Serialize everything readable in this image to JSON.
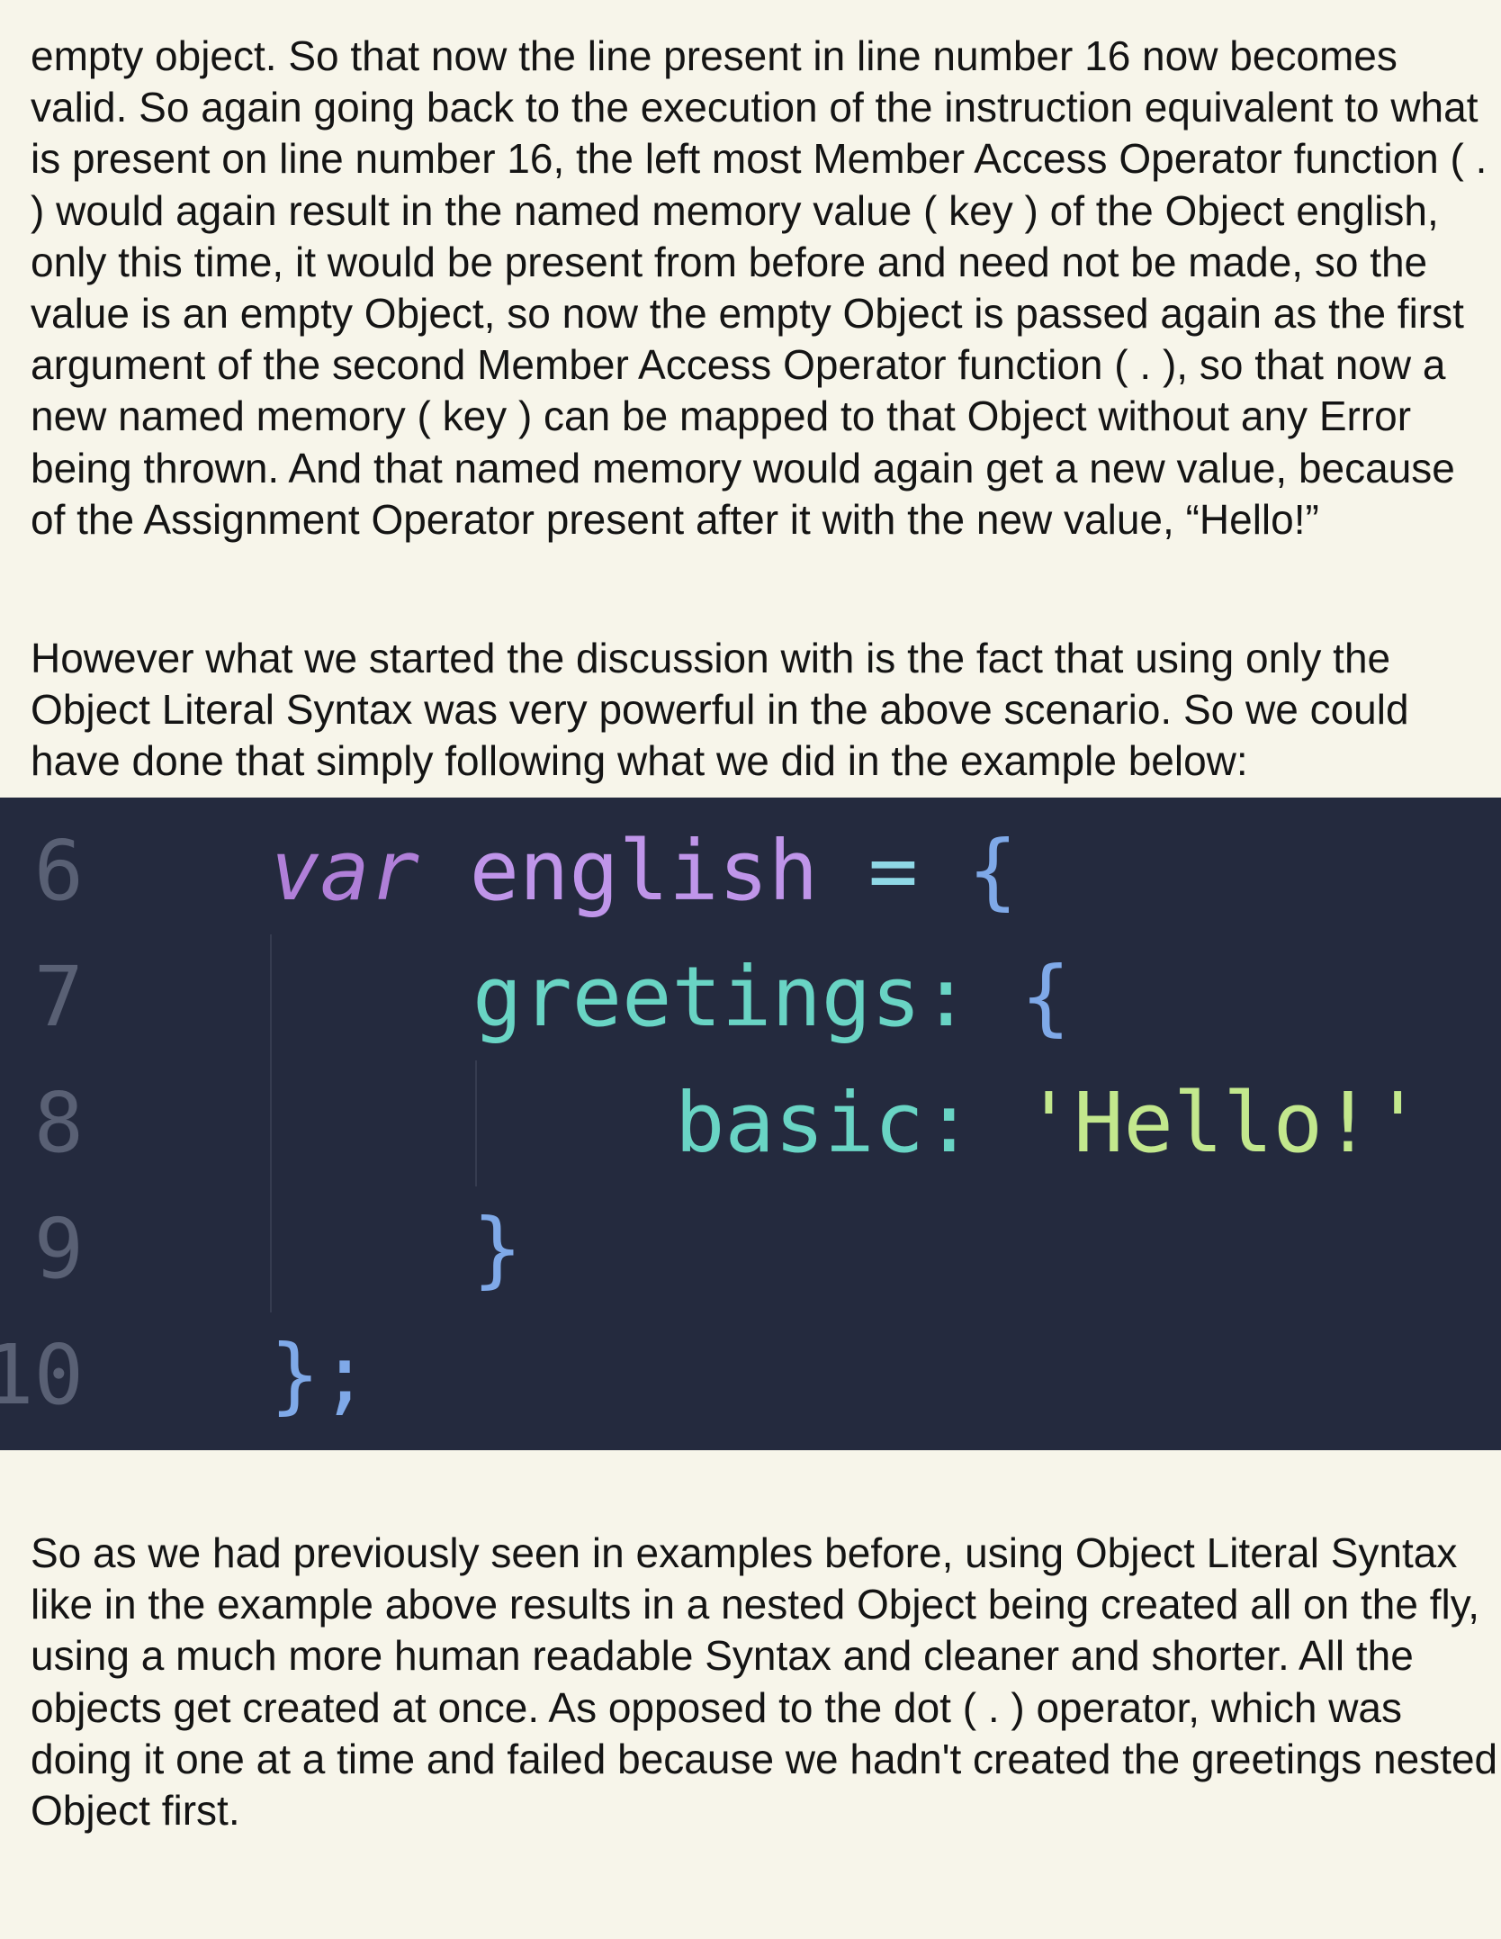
{
  "paragraphs": [
    "empty object. So that now the line present in line number 16 now becomes valid. So again going back to the execution of the instruction equivalent to what is present on line number 16, the left most Member Access Operator function ( . ) would again result in the named memory value ( key ) of the Object english, only this time, it would be present from before and need not be made, so the value is an empty Object, so now the empty Object is passed again as the first argument of the second Member Access Operator function ( . ), so that now a new named memory ( key ) can be mapped to that Object without any Error being thrown. And that named memory would again get a new value, because of the Assignment Operator present after it with the new value, “Hello!”",
    "However what we started the discussion with is the fact that using only the Object Literal Syntax was very powerful in the above scenario. So we could have done that simply following what we did in the example below:",
    "So as we had previously seen in examples before, using Object Literal Syntax like in the example above results in a nested Object being created all on the fly, using a much more human readable Syntax and cleaner and shorter. All the objects get created at once. As opposed to the dot ( . ) operator, which was doing it one at a time and failed because we hadn't created the greetings nested Object first."
  ],
  "code": {
    "lines": [
      {
        "number": "6",
        "keyword": "var",
        "name": "english",
        "equals": "=",
        "open": "{"
      },
      {
        "number": "7",
        "property": "greetings",
        "colon": ":",
        "open": "{"
      },
      {
        "number": "8",
        "property": "basic",
        "colon": ":",
        "string": "'Hello!'"
      },
      {
        "number": "9",
        "close": "}"
      },
      {
        "number": "10",
        "close": "};"
      }
    ]
  },
  "colors": {
    "page_background": "#f7f5ea",
    "code_background": "#242a3e",
    "keyword": "#b07fd8",
    "variable": "#bf95e9",
    "property": "#69d4c4",
    "string": "#c3e88d",
    "brace": "#7fa9e8",
    "line_number": "#596074"
  }
}
